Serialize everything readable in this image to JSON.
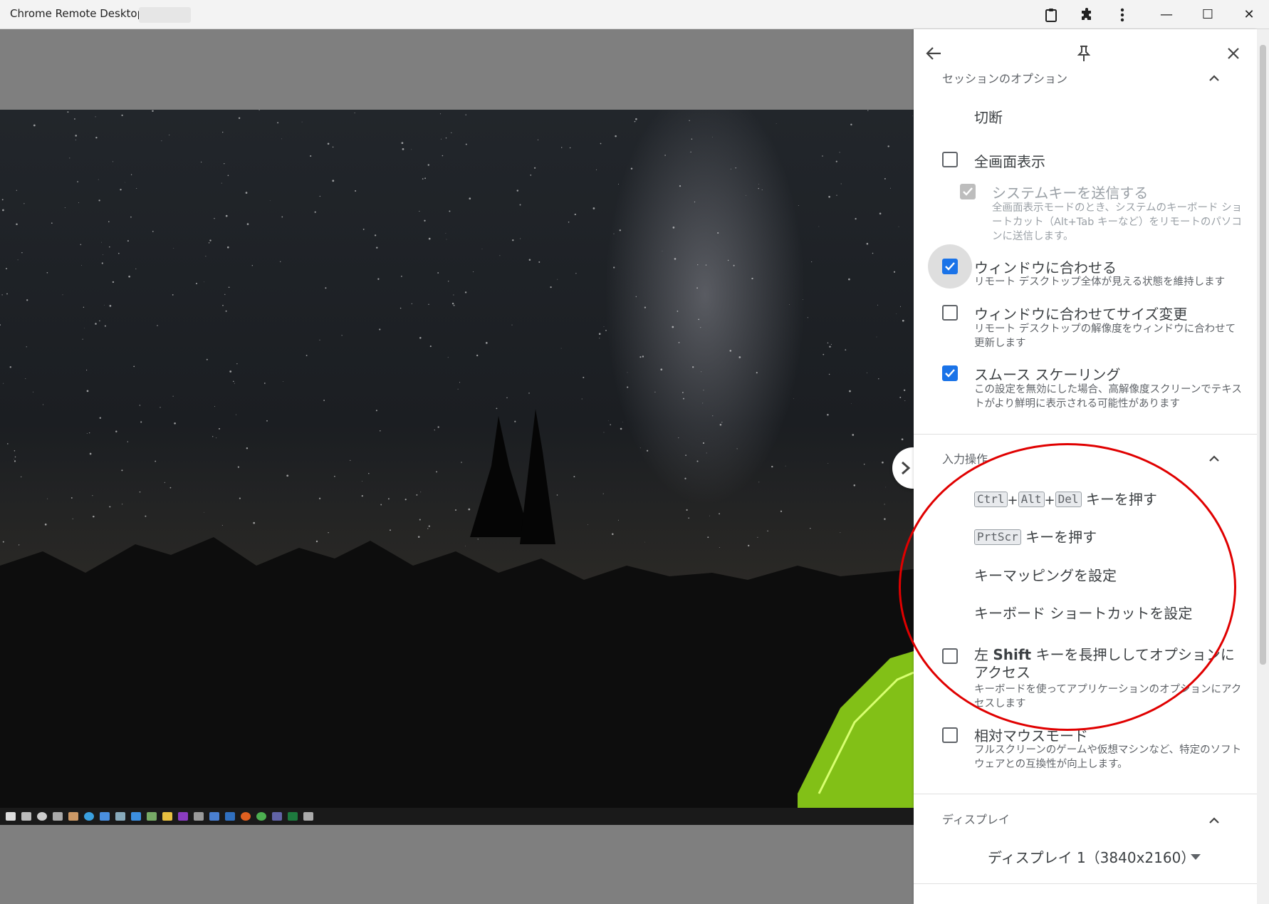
{
  "window": {
    "title": "Chrome Remote Desktop -",
    "icons": [
      "clipboard-icon",
      "puzzle-icon",
      "more-vert-icon"
    ],
    "controls": {
      "minimize": "—",
      "maximize": "☐",
      "close": "✕"
    }
  },
  "panel": {
    "header": {
      "back": "back-arrow-icon",
      "pin": "pin-icon",
      "close": "close-icon"
    },
    "session": {
      "title": "セッションのオプション",
      "disconnect": "切断",
      "fullscreen": {
        "label": "全画面表示",
        "checked": false
      },
      "send_system_keys": {
        "label": "システムキーを送信する",
        "desc": "全画面表示モードのとき、システムのキーボード ショートカット（Alt+Tab キーなど）をリモートのパソコンに送信します。",
        "checked": true,
        "disabled": true
      },
      "fit_window": {
        "label": "ウィンドウに合わせる",
        "desc": "リモート デスクトップ全体が見える状態を維持します",
        "checked": true
      },
      "resize_to_fit": {
        "label": "ウィンドウに合わせてサイズ変更",
        "desc": "リモート デスクトップの解像度をウィンドウに合わせて更新します",
        "checked": false
      },
      "smooth_scaling": {
        "label": "スムース スケーリング",
        "desc": "この設定を無効にした場合、高解像度スクリーンでテキストがより鮮明に表示される可能性があります",
        "checked": true
      }
    },
    "input": {
      "title": "入力操作",
      "cad": {
        "keys": [
          "Ctrl",
          "Alt",
          "Del"
        ],
        "plus": "+",
        "suffix": "キーを押す"
      },
      "prtscr": {
        "key": "PrtScr",
        "suffix": "キーを押す"
      },
      "key_mapping": "キーマッピングを設定",
      "keyboard_shortcuts": "キーボード ショートカットを設定",
      "left_shift": {
        "label_pre": "左",
        "label_key": "Shift",
        "label_post": "キーを長押ししてオプションにアクセス",
        "desc": "キーボードを使ってアプリケーションのオプションにアクセスします",
        "checked": false
      },
      "relative_mouse": {
        "label": "相対マウスモード",
        "desc": "フルスクリーンのゲームや仮想マシンなど、特定のソフトウェアとの互換性が向上します。",
        "checked": false
      }
    },
    "display": {
      "title": "ディスプレイ",
      "selected": "ディスプレイ 1（3840x2160）"
    }
  },
  "colors": {
    "accent": "#1a73e8",
    "annotation": "#e00000"
  }
}
